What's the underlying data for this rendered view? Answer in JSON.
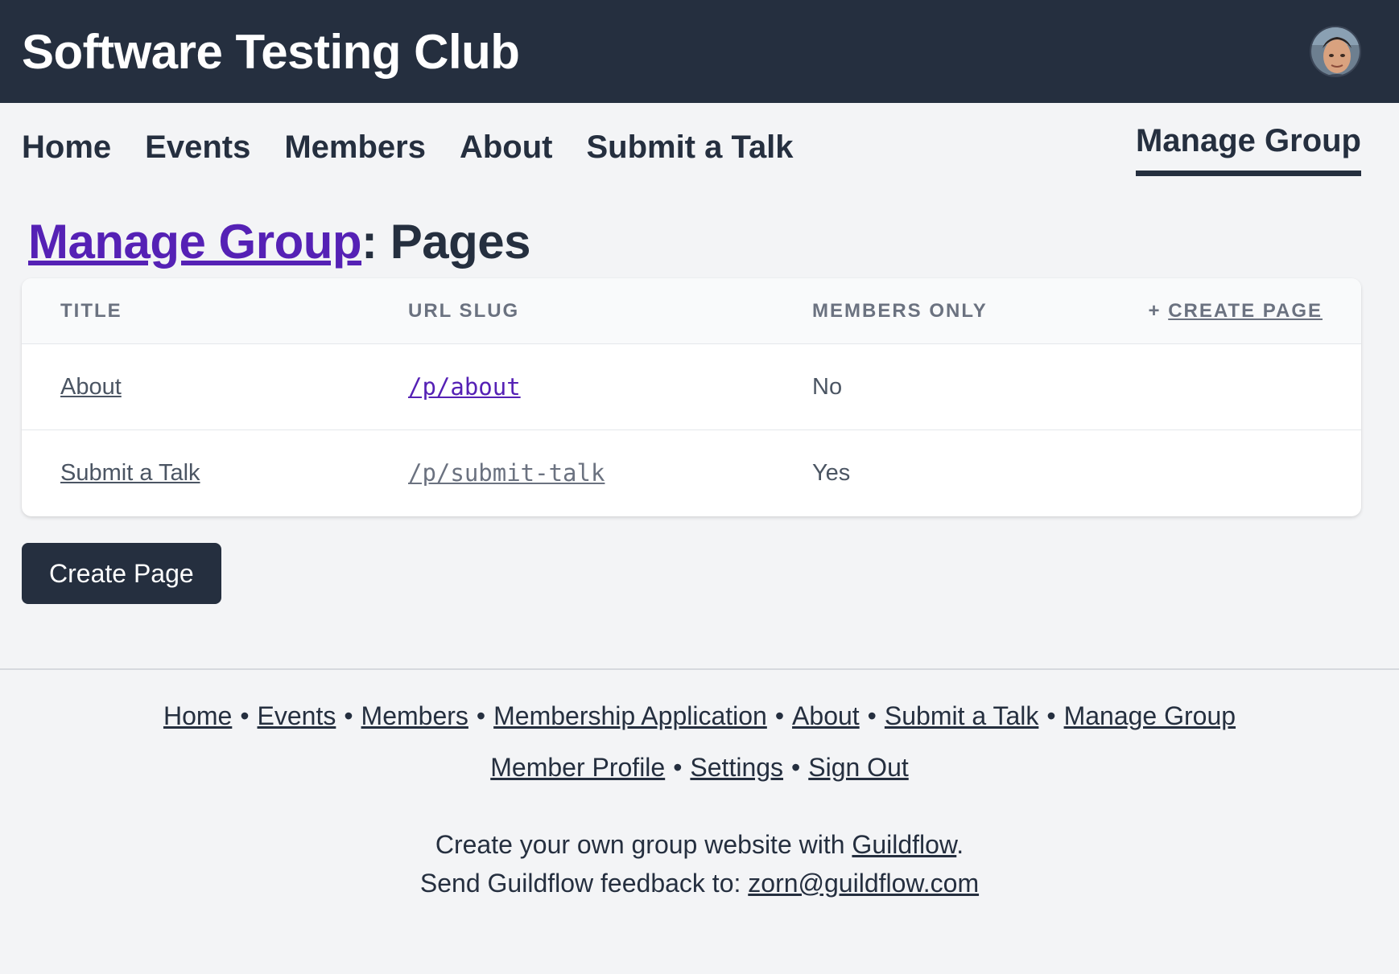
{
  "header": {
    "site_title": "Software Testing Club",
    "avatar_icon": "user-avatar-photo"
  },
  "nav": {
    "items": [
      {
        "label": "Home"
      },
      {
        "label": "Events"
      },
      {
        "label": "Members"
      },
      {
        "label": "About"
      },
      {
        "label": "Submit a Talk"
      }
    ],
    "active": "Manage Group"
  },
  "page": {
    "breadcrumb": "Manage Group",
    "separator": ":",
    "title": "Pages"
  },
  "table": {
    "columns": [
      "TITLE",
      "URL SLUG",
      "MEMBERS ONLY"
    ],
    "create_prefix": "+",
    "create_label": "CREATE PAGE",
    "rows": [
      {
        "title": "About",
        "slug": "/p/about",
        "members_only": "No"
      },
      {
        "title": "Submit a Talk",
        "slug": "/p/submit-talk",
        "members_only": "Yes"
      }
    ]
  },
  "actions": {
    "create_button": "Create Page"
  },
  "footer": {
    "links_row1": [
      "Home",
      "Events",
      "Members",
      "Membership Application",
      "About",
      "Submit a Talk",
      "Manage Group"
    ],
    "links_row2": [
      "Member Profile",
      "Settings",
      "Sign Out"
    ],
    "bullet": "•",
    "note_line1_prefix": "Create your own group website with ",
    "note_line1_link": "Guildflow",
    "note_line1_suffix": ".",
    "note_line2_prefix": "Send Guildflow feedback to: ",
    "note_line2_link": "zorn@guildflow.com"
  },
  "colors": {
    "header_bg": "#252f3f",
    "accent_link": "#5521b5",
    "page_bg": "#f3f4f6"
  }
}
